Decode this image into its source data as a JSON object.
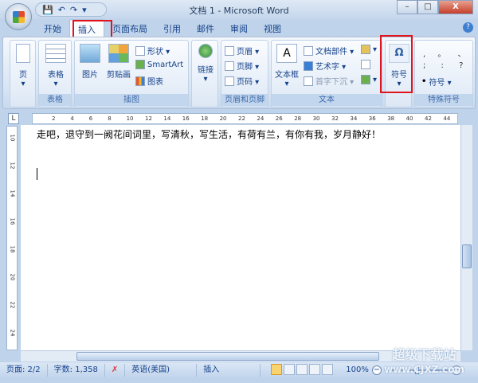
{
  "window": {
    "title": "文档 1 - Microsoft Word",
    "minimize": "–",
    "maximize": "□",
    "close": "X"
  },
  "qat": {
    "save": "💾",
    "undo": "↶",
    "redo": "↷",
    "customize": "▾"
  },
  "tabs": [
    "开始",
    "插入",
    "页面布局",
    "引用",
    "邮件",
    "审阅",
    "视图"
  ],
  "help": "?",
  "ribbon": {
    "groups": {
      "pages": "",
      "tables": "表格",
      "illustrations": "插图",
      "links": "",
      "header_footer": "页眉和页脚",
      "text": "文本",
      "symbols": "",
      "special_symbols": "特殊符号"
    },
    "page": "页",
    "table": "表格",
    "picture": "图片",
    "clipart": "剪贴画",
    "shapes": "形状 ▾",
    "smartart": "SmartArt",
    "chart": "图表",
    "link": "链接",
    "header": "页眉 ▾",
    "footer": "页脚 ▾",
    "page_number": "页码 ▾",
    "textbox": "文本框",
    "quickparts": "文档部件 ▾",
    "wordart": "艺术字 ▾",
    "dropcap": "首字下沉 ▾",
    "symbol": "符号",
    "symbol_glyph": "Ω",
    "special_row1": ", 。 、",
    "special_row2": "; : ?",
    "special_symbol": "符号 ▾"
  },
  "ruler": {
    "corner": "L",
    "h_ticks": [
      "2",
      "4",
      "6",
      "8",
      "10",
      "12",
      "14",
      "16",
      "18",
      "20",
      "22",
      "24",
      "26",
      "28",
      "30",
      "32",
      "34",
      "36",
      "38",
      "40",
      "42",
      "44"
    ],
    "v_ticks": [
      "10",
      "12",
      "14",
      "16",
      "18",
      "20",
      "22",
      "24"
    ]
  },
  "document": {
    "text": "走吧，退守到一阙花间词里，写清秋，写生活，有荷有兰，有你有我，岁月静好！"
  },
  "status": {
    "page": "页面: 2/2",
    "words": "字数: 1,358",
    "language": "英语(美国)",
    "mode": "插入",
    "zoom": "100%"
  },
  "watermark": {
    "line1": "超级下载站",
    "line2": "www.CJXZ.com"
  }
}
